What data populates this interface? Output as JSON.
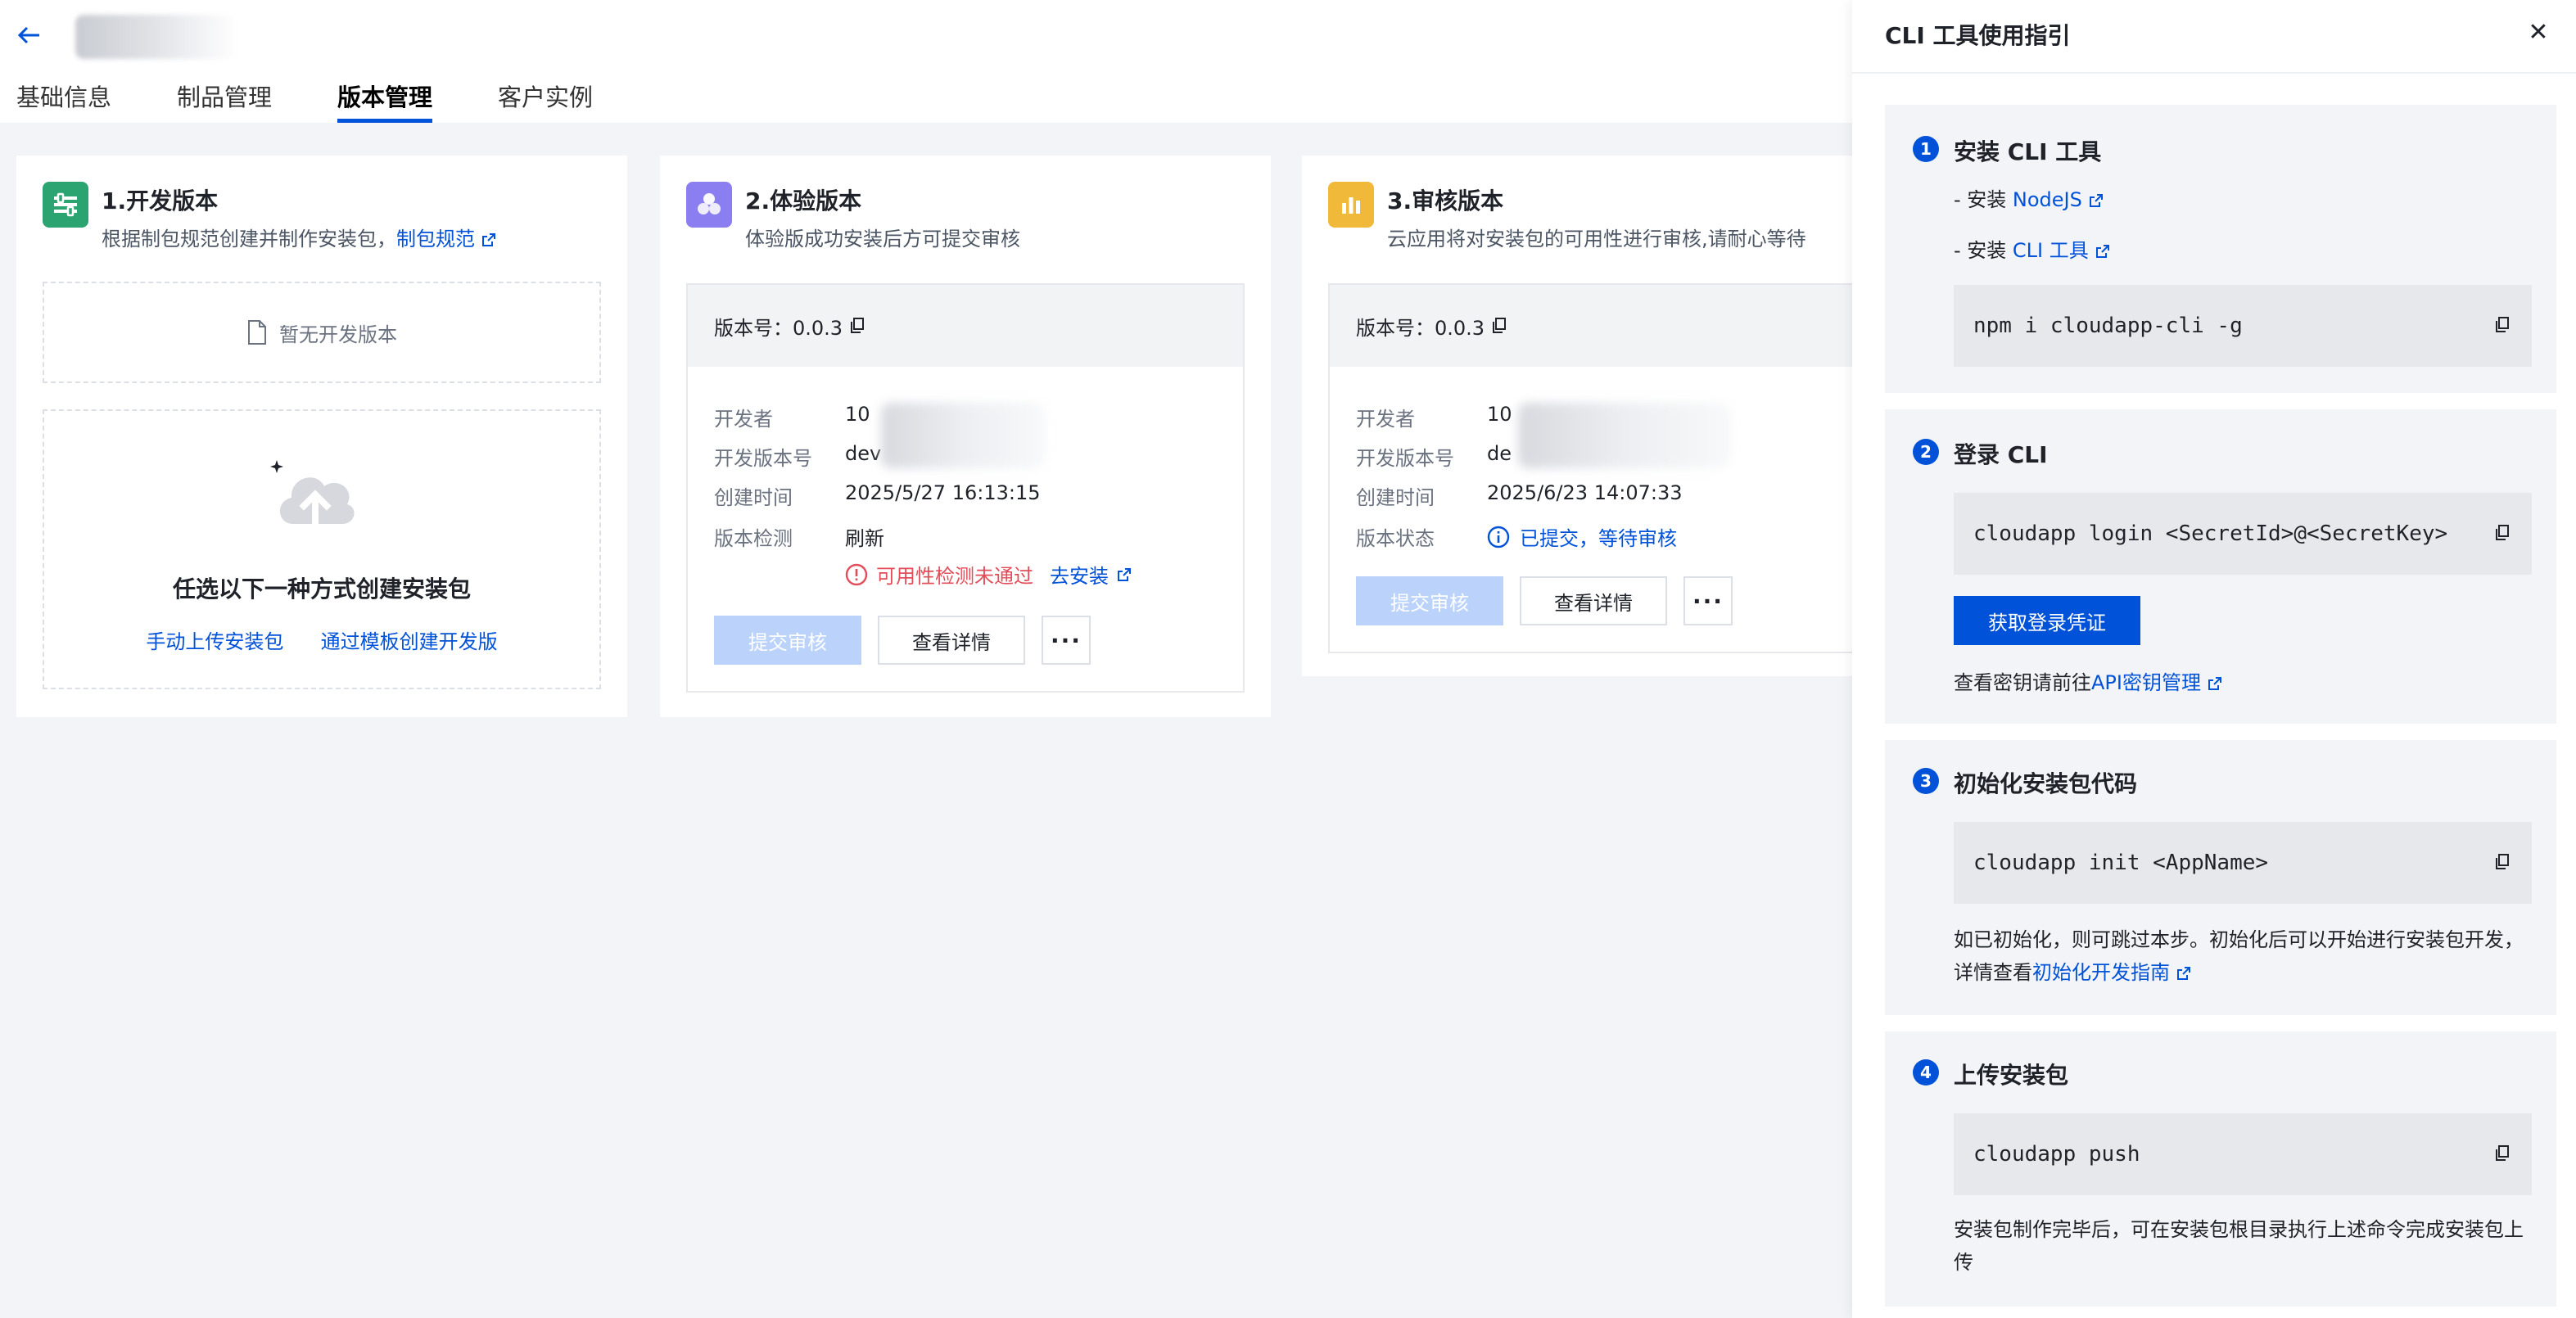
{
  "colors": {
    "brand": "#0052d9",
    "error": "#e34d59",
    "dev_icon": "#2ba471",
    "exp_icon": "#8b7ef0",
    "review_icon": "#f0b93a"
  },
  "header": {
    "tabs": [
      "基础信息",
      "制品管理",
      "版本管理",
      "客户实例"
    ],
    "active_tab": "版本管理"
  },
  "dev_card": {
    "title": "1.开发版本",
    "subtitle": "根据制包规范创建并制作安装包，",
    "subtitle_link": "制包规范",
    "empty_text": "暂无开发版本",
    "create_title": "任选以下一种方式创建安装包",
    "upload_link": "手动上传安装包",
    "template_link": "通过模板创建开发版"
  },
  "exp_card": {
    "title": "2.体验版本",
    "subtitle": "体验版成功安装后方可提交审核",
    "version": "版本号：0.0.3",
    "rows": {
      "developer": {
        "k": "开发者",
        "v": "10"
      },
      "dev_version": {
        "k": "开发版本号",
        "v": "dev"
      },
      "created": {
        "k": "创建时间",
        "v": "2025/5/27 16:13:15"
      },
      "check": {
        "k": "版本检测",
        "v": "刷新"
      }
    },
    "check_error": "可用性检测未通过",
    "install_link": "去安装",
    "submit_btn": "提交审核",
    "detail_btn": "查看详情",
    "more_btn": "···"
  },
  "review_card": {
    "title": "3.审核版本",
    "subtitle": "云应用将对安装包的可用性进行审核,请耐心等待",
    "version": "版本号：0.0.3",
    "rows": {
      "developer": {
        "k": "开发者",
        "v": "10"
      },
      "dev_version": {
        "k": "开发版本号",
        "v": "de"
      },
      "created": {
        "k": "创建时间",
        "v": "2025/6/23 14:07:33"
      },
      "status": {
        "k": "版本状态",
        "v": "已提交，等待审核"
      }
    },
    "submit_btn": "提交审核",
    "detail_btn": "查看详情",
    "more_btn": "···"
  },
  "drawer": {
    "title": "CLI 工具使用指引",
    "close": "✕",
    "step1": {
      "num": "1",
      "title": "安装 CLI 工具",
      "line1_prefix": "- 安装 ",
      "line1_link": "NodeJS",
      "line2_prefix": "- 安装 ",
      "line2_link": "CLI 工具",
      "code": "npm i cloudapp-cli -g"
    },
    "step2": {
      "num": "2",
      "title": "登录 CLI",
      "code": "cloudapp login <SecretId>@<SecretKey>",
      "button": "获取登录凭证",
      "note_prefix": "查看密钥请前往",
      "note_link": "API密钥管理"
    },
    "step3": {
      "num": "3",
      "title": "初始化安装包代码",
      "code": "cloudapp init <AppName>",
      "para": "如已初始化，则可跳过本步。初始化后可以开始进行安装包开发，详情查看",
      "para_link": "初始化开发指南"
    },
    "step4": {
      "num": "4",
      "title": "上传安装包",
      "code": "cloudapp push",
      "para": "安装包制作完毕后，可在安装包根目录执行上述命令完成安装包上传"
    }
  }
}
